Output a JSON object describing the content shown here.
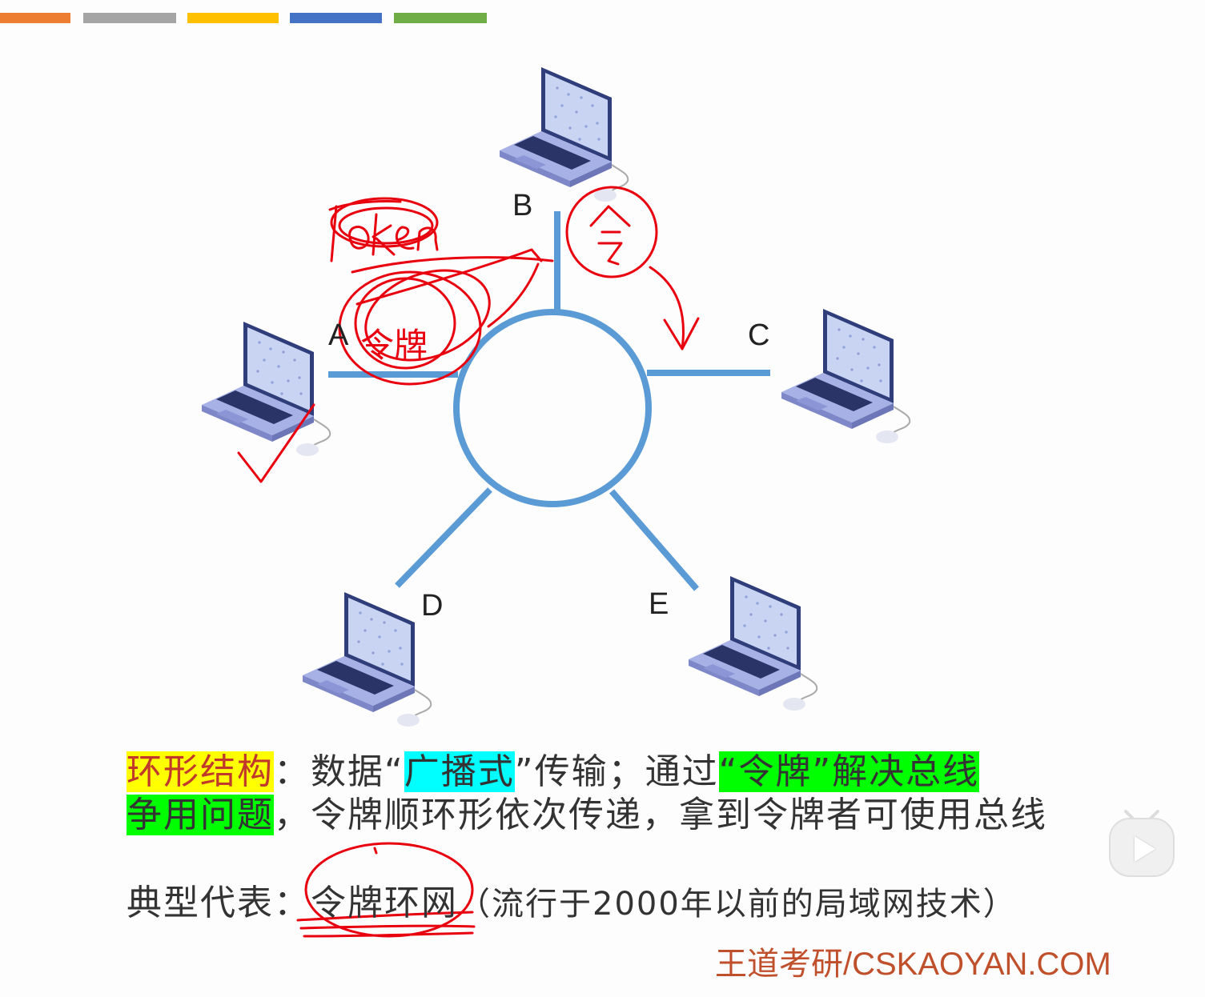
{
  "top_stripes": [
    {
      "color": "#ed7d31"
    },
    {
      "color": "#a5a5a5"
    },
    {
      "color": "#ffc000"
    },
    {
      "color": "#4472c4"
    },
    {
      "color": "#70ad47"
    }
  ],
  "diagram": {
    "ring_color": "#5b9bd5",
    "nodes": [
      {
        "id": "A",
        "label": "A"
      },
      {
        "id": "B",
        "label": "B"
      },
      {
        "id": "C",
        "label": "C"
      },
      {
        "id": "D",
        "label": "D"
      },
      {
        "id": "E",
        "label": "E"
      }
    ],
    "handwritten_annotations": [
      "Token",
      "令牌",
      "令"
    ]
  },
  "text": {
    "line1": {
      "term": "环形结构",
      "colon": "：数据“",
      "broadcast": "广播式",
      "middle": "”传输；通过",
      "token_solution": "“令牌”解决总线"
    },
    "line2": {
      "contention": "争用问题",
      "rest": "，令牌顺环形依次传递，拿到令牌者可使用总线"
    },
    "line3": {
      "prefix": "典型代表：",
      "example": "令牌环网",
      "note": "（流行于2000年以前的局域网技术）"
    }
  },
  "watermark": "王道考研/CSKAOYAN.COM",
  "ui": {
    "play_button": "play-icon"
  }
}
